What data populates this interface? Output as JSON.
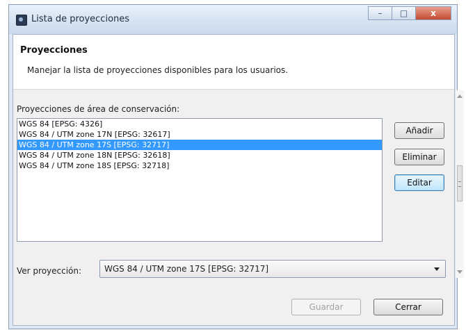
{
  "window": {
    "title": "Lista de proyecciones",
    "controls": {
      "minimize": "–",
      "maximize": "□",
      "close": "x"
    }
  },
  "banner": {
    "title": "Proyecciones",
    "description": "Manejar la lista de proyecciones disponibles para los usuarios."
  },
  "section": {
    "label": "Proyecciones de área de conservación:"
  },
  "list": {
    "items": [
      "WGS 84 [EPSG: 4326]",
      "WGS 84 / UTM zone 17N [EPSG: 32617]",
      "WGS 84 / UTM zone 17S [EPSG: 32717]",
      "WGS 84 / UTM zone 18N [EPSG: 32618]",
      "WGS 84 / UTM zone 18S [EPSG: 32718]"
    ],
    "selected_index": 2
  },
  "buttons": {
    "add": "Añadir",
    "remove": "Eliminar",
    "edit": "Editar",
    "save": "Guardar",
    "close": "Cerrar"
  },
  "view": {
    "label": "Ver proyección:",
    "selected": "WGS 84 / UTM zone 17S [EPSG: 32717]"
  },
  "colors": {
    "selection": "#3399ff",
    "banner_bg": "#ffffff",
    "dialog_bg": "#f0f0f0"
  }
}
